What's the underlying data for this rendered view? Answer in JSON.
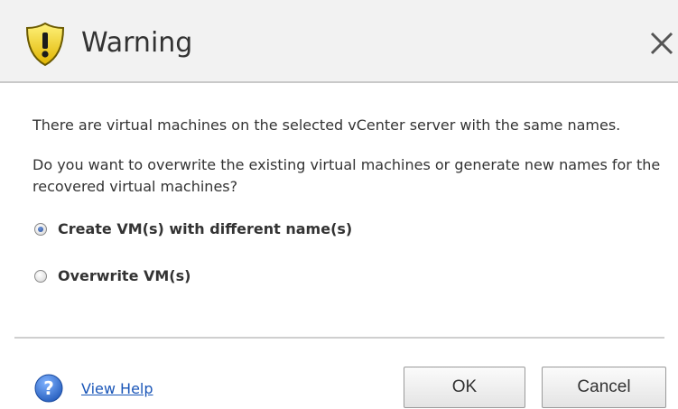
{
  "dialog": {
    "title": "Warning",
    "icon": "warning-shield-icon",
    "message_line1": "There are virtual machines on the selected vCenter server with the same names.",
    "message_line2": "Do you want to overwrite the existing virtual machines or generate new names for the recovered virtual machines?"
  },
  "options": [
    {
      "label": "Create VM(s) with different name(s)",
      "selected": true
    },
    {
      "label": "Overwrite VM(s)",
      "selected": false
    }
  ],
  "footer": {
    "help_label": "View Help",
    "ok_label": "OK",
    "cancel_label": "Cancel"
  },
  "colors": {
    "accent_link": "#1a56b8",
    "shield_yellow": "#f3d21c",
    "help_blue": "#2f6fd0"
  }
}
